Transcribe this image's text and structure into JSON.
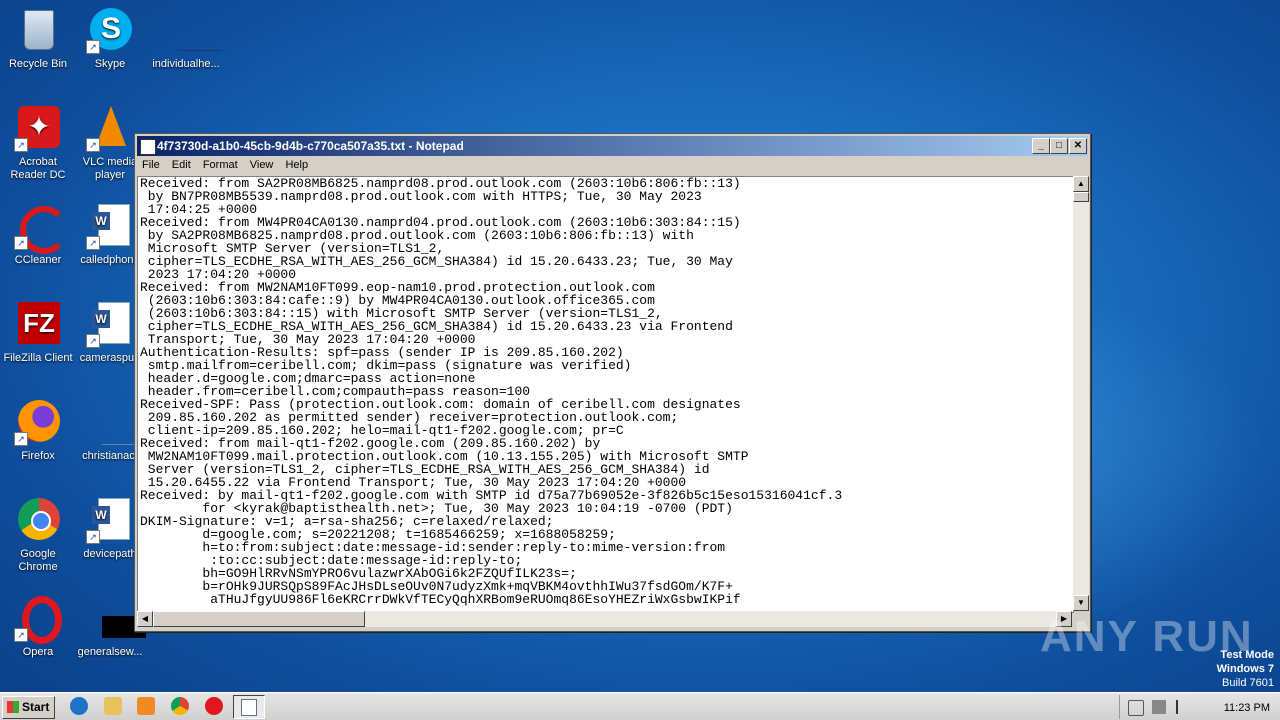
{
  "desktop": {
    "icons": [
      {
        "label": "Recycle Bin",
        "icon": "recycle-bin-icon"
      },
      {
        "label": "Skype",
        "icon": "skype-icon"
      },
      {
        "label": "individualhe...",
        "icon": "document-icon"
      },
      {
        "label": "Acrobat Reader DC",
        "icon": "acrobat-icon"
      },
      {
        "label": "VLC media player",
        "icon": "vlc-icon"
      },
      {
        "label": "CCleaner",
        "icon": "ccleaner-icon"
      },
      {
        "label": "calledphone",
        "icon": "word-doc-icon"
      },
      {
        "label": "FileZilla Client",
        "icon": "filezilla-icon"
      },
      {
        "label": "cameraspun",
        "icon": "word-doc-icon"
      },
      {
        "label": "Firefox",
        "icon": "firefox-icon"
      },
      {
        "label": "christianact",
        "icon": "document-icon"
      },
      {
        "label": "Google Chrome",
        "icon": "chrome-icon"
      },
      {
        "label": "devicepath",
        "icon": "word-doc-icon"
      },
      {
        "label": "Opera",
        "icon": "opera-icon"
      },
      {
        "label": "generalsew...",
        "icon": "document-icon"
      }
    ]
  },
  "window": {
    "title": "4f73730d-a1b0-45cb-9d4b-c770ca507a35.txt - Notepad",
    "menu": [
      "File",
      "Edit",
      "Format",
      "View",
      "Help"
    ],
    "content": "Received: from SA2PR08MB6825.namprd08.prod.outlook.com (2603:10b6:806:fb::13)\n by BN7PR08MB5539.namprd08.prod.outlook.com with HTTPS; Tue, 30 May 2023\n 17:04:25 +0000\nReceived: from MW4PR04CA0130.namprd04.prod.outlook.com (2603:10b6:303:84::15)\n by SA2PR08MB6825.namprd08.prod.outlook.com (2603:10b6:806:fb::13) with\n Microsoft SMTP Server (version=TLS1_2,\n cipher=TLS_ECDHE_RSA_WITH_AES_256_GCM_SHA384) id 15.20.6433.23; Tue, 30 May\n 2023 17:04:20 +0000\nReceived: from MW2NAM10FT099.eop-nam10.prod.protection.outlook.com\n (2603:10b6:303:84:cafe::9) by MW4PR04CA0130.outlook.office365.com\n (2603:10b6:303:84::15) with Microsoft SMTP Server (version=TLS1_2,\n cipher=TLS_ECDHE_RSA_WITH_AES_256_GCM_SHA384) id 15.20.6433.23 via Frontend\n Transport; Tue, 30 May 2023 17:04:20 +0000\nAuthentication-Results: spf=pass (sender IP is 209.85.160.202)\n smtp.mailfrom=ceribell.com; dkim=pass (signature was verified)\n header.d=google.com;dmarc=pass action=none\n header.from=ceribell.com;compauth=pass reason=100\nReceived-SPF: Pass (protection.outlook.com: domain of ceribell.com designates\n 209.85.160.202 as permitted sender) receiver=protection.outlook.com;\n client-ip=209.85.160.202; helo=mail-qt1-f202.google.com; pr=C\nReceived: from mail-qt1-f202.google.com (209.85.160.202) by\n MW2NAM10FT099.mail.protection.outlook.com (10.13.155.205) with Microsoft SMTP\n Server (version=TLS1_2, cipher=TLS_ECDHE_RSA_WITH_AES_256_GCM_SHA384) id\n 15.20.6455.22 via Frontend Transport; Tue, 30 May 2023 17:04:20 +0000\nReceived: by mail-qt1-f202.google.com with SMTP id d75a77b69052e-3f826b5c15eso15316041cf.3\n        for <kyrak@baptisthealth.net>; Tue, 30 May 2023 10:04:19 -0700 (PDT)\nDKIM-Signature: v=1; a=rsa-sha256; c=relaxed/relaxed;\n        d=google.com; s=20221208; t=1685466259; x=1688058259;\n        h=to:from:subject:date:message-id:sender:reply-to:mime-version:from\n         :to:cc:subject:date:message-id:reply-to;\n        bh=GO9HlRRvNSmYPRO6vulazwrXAbOGi6k2FZQUfILK23s=;\n        b=rOHk9JURSQpS89FAcJHsDLseOUv0N7udyzXmk+mqVBKM4ovthhIWu37fsdGOm/K7F+\n         aTHuJfgyUU986Fl6eKRCrrDWkVfTECyQqhXRBom9eRUOmq86EsoYHEZriWxGsbwIKPif"
  },
  "watermark": {
    "brand": "ANY RUN"
  },
  "testmode": {
    "line1": "Test Mode",
    "line2": "Windows 7",
    "line3": "Build 7601"
  },
  "taskbar": {
    "start_label": "Start",
    "clock": "11:23 PM"
  }
}
